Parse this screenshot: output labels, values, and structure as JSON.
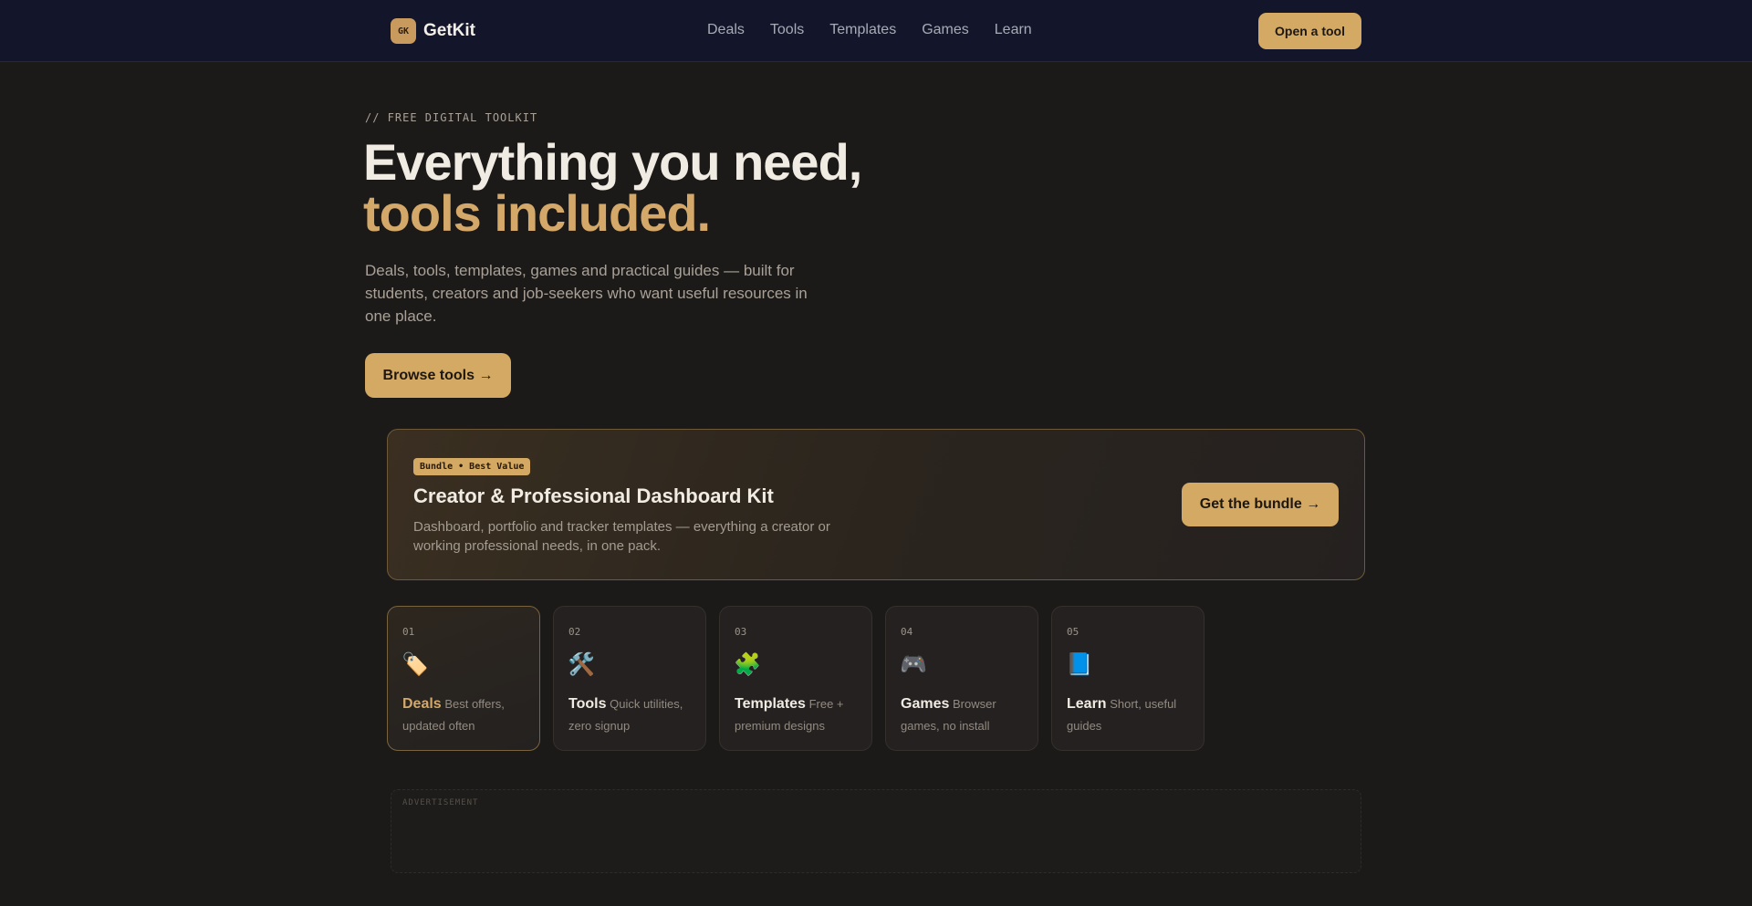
{
  "nav": {
    "logo_badge": "GK",
    "brand": "GetKit",
    "links": [
      "Deals",
      "Tools",
      "Templates",
      "Games",
      "Learn"
    ],
    "cta": "Open a tool"
  },
  "hero": {
    "eyebrow": "// FREE DIGITAL TOOLKIT",
    "title_line1": "Everything you need,",
    "title_line2": "tools included.",
    "description": "Deals, tools, templates, games and practical guides — built for students, creators and job-seekers who want useful resources in one place.",
    "browse_button": "Browse tools →"
  },
  "bundle": {
    "badge": "Bundle • Best Value",
    "title": "Creator & Professional Dashboard Kit",
    "description": "Dashboard, portfolio and tracker templates — everything a creator or working professional needs, in one pack.",
    "button": "Get the bundle →"
  },
  "categories": [
    {
      "num": "01",
      "icon": "🏷️",
      "icon_name": "tag-icon",
      "name": "Deals",
      "desc": "Best offers, updated often"
    },
    {
      "num": "02",
      "icon": "🛠️",
      "icon_name": "tools-icon",
      "name": "Tools",
      "desc": "Quick utilities, zero signup"
    },
    {
      "num": "03",
      "icon": "🧩",
      "icon_name": "puzzle-icon",
      "name": "Templates",
      "desc": "Free + premium designs"
    },
    {
      "num": "04",
      "icon": "🎮",
      "icon_name": "gamepad-icon",
      "name": "Games",
      "desc": "Browser games, no install"
    },
    {
      "num": "05",
      "icon": "📘",
      "icon_name": "book-icon",
      "name": "Learn",
      "desc": "Short, useful guides"
    }
  ],
  "ad": {
    "label": "ADVERTISEMENT"
  },
  "colors": {
    "accent": "#d4a964",
    "nav_bg": "#13162a",
    "page_bg": "#1c1a18"
  }
}
